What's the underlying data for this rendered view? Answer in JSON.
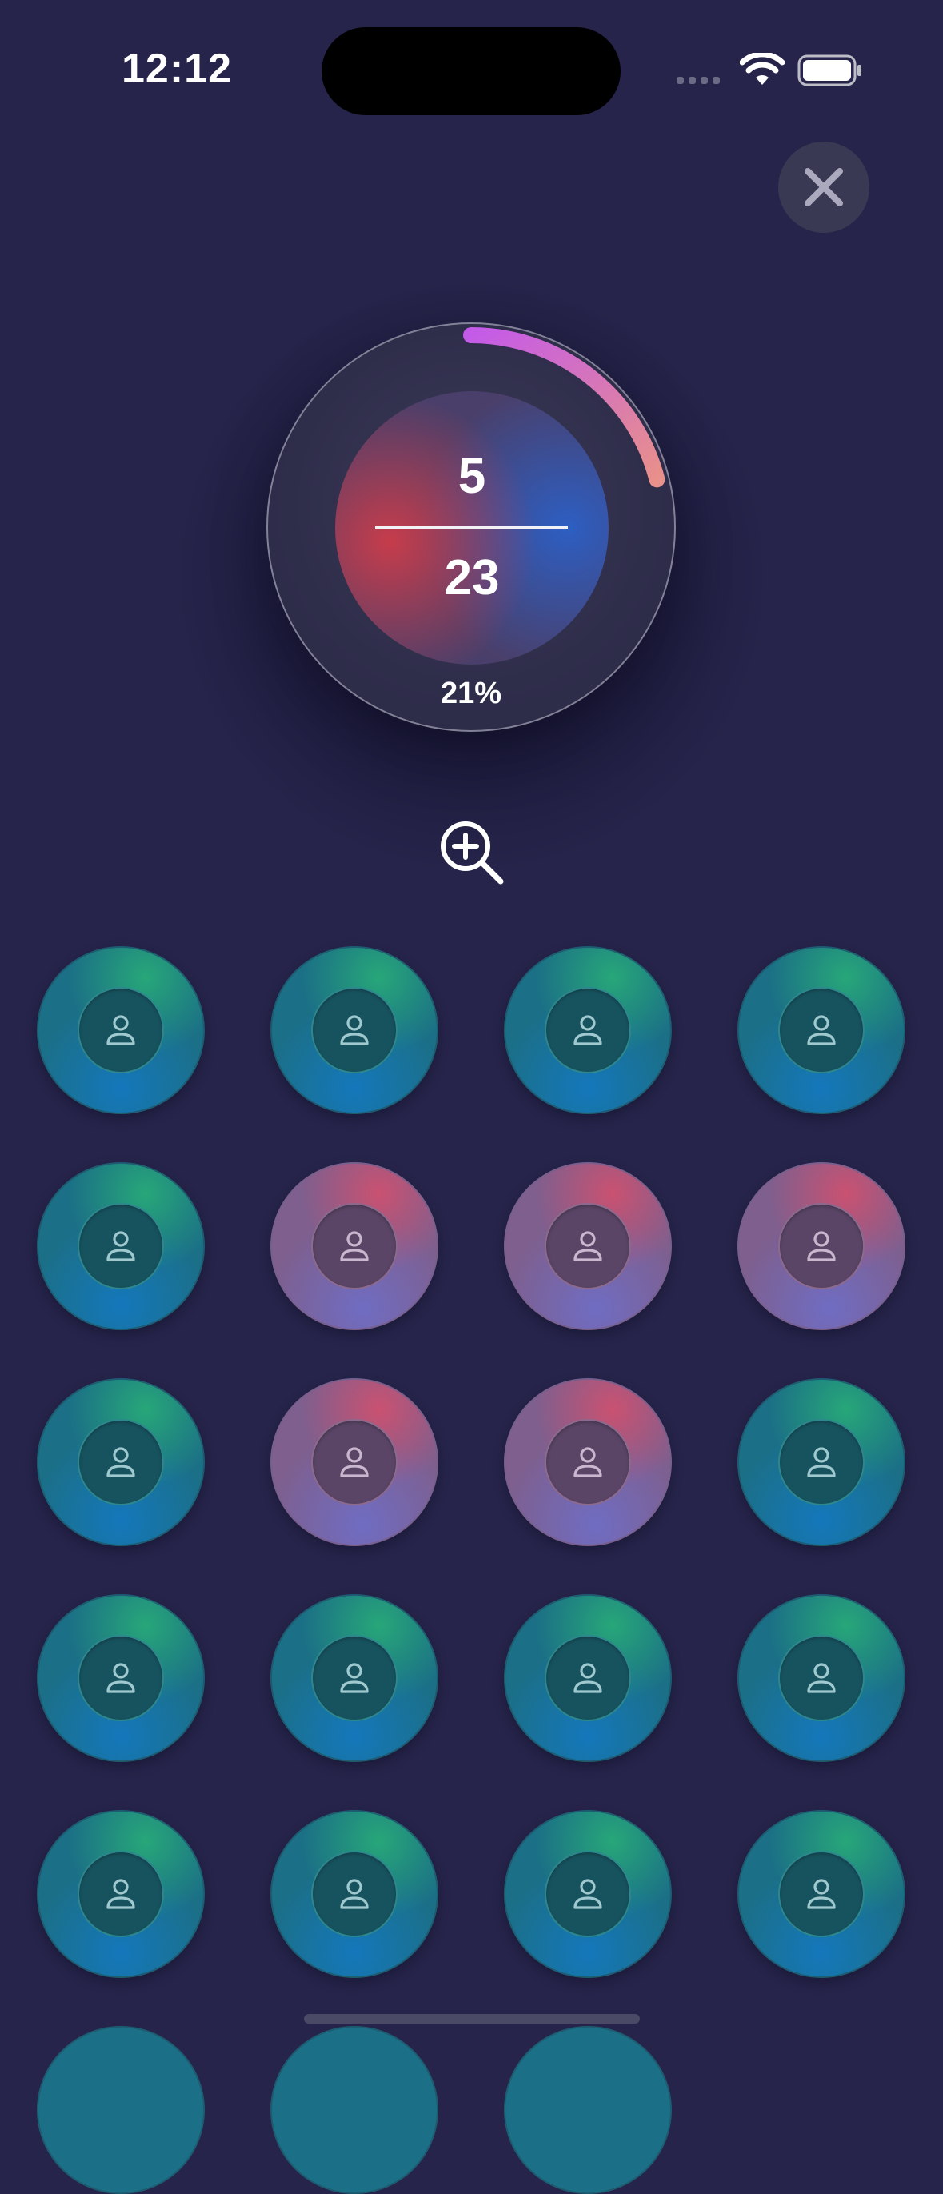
{
  "status_bar": {
    "time": "12:12",
    "icons": [
      "cellular-signal-icon",
      "wifi-icon",
      "battery-icon"
    ]
  },
  "header": {
    "close_icon": "close-icon"
  },
  "progress": {
    "current": "5",
    "total": "23",
    "percent_label": "21%",
    "fraction": 0.21,
    "arc_gradient": [
      "#c45be8",
      "#e8908a"
    ]
  },
  "zoom_icon": "zoom-in-icon",
  "nodes": [
    {
      "style": "teal"
    },
    {
      "style": "teal"
    },
    {
      "style": "teal"
    },
    {
      "style": "teal"
    },
    {
      "style": "teal"
    },
    {
      "style": "pink"
    },
    {
      "style": "pink"
    },
    {
      "style": "pink"
    },
    {
      "style": "teal"
    },
    {
      "style": "pink"
    },
    {
      "style": "pink"
    },
    {
      "style": "teal"
    },
    {
      "style": "teal"
    },
    {
      "style": "teal"
    },
    {
      "style": "teal"
    },
    {
      "style": "teal"
    },
    {
      "style": "teal"
    },
    {
      "style": "teal"
    },
    {
      "style": "teal"
    },
    {
      "style": "teal"
    }
  ],
  "node_icon": "person-icon",
  "colors": {
    "background": "#26244a",
    "teal_node": "#1b6f86",
    "pink_node": "#7e5f8e"
  }
}
